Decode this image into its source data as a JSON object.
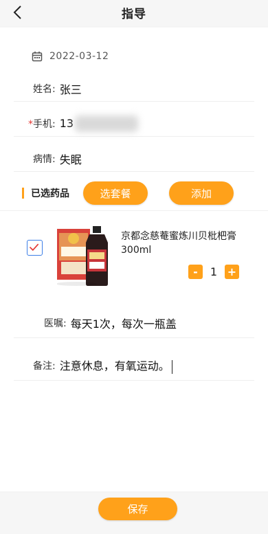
{
  "header": {
    "title": "指导"
  },
  "record": {
    "date": "2022-03-12"
  },
  "fields": {
    "name_label": "姓名:",
    "name_value": "张三",
    "phone_star": "*",
    "phone_label": "手机:",
    "phone_visible": "13",
    "condition_label": "病情:",
    "condition_value": "失眠"
  },
  "section": {
    "title": "已选药品",
    "select_package_label": "选套餐",
    "add_label": "添加"
  },
  "medicine": {
    "name": "京都念慈菴蜜炼川贝枇杷膏300ml",
    "quantity": "1",
    "minus": "-",
    "plus": "+",
    "checked": true
  },
  "advice": {
    "label": "医嘱:",
    "value": "每天1次，每次一瓶盖"
  },
  "notes": {
    "label": "备注:",
    "value": "注意休息，有氧运动。"
  },
  "footer": {
    "save_label": "保存"
  },
  "colors": {
    "accent": "#ffa11a",
    "checkbox": "#3b7de6",
    "required": "#e53935"
  },
  "icons": {
    "back": "chevron-left-icon",
    "date": "calendar-icon",
    "check": "check-icon"
  }
}
